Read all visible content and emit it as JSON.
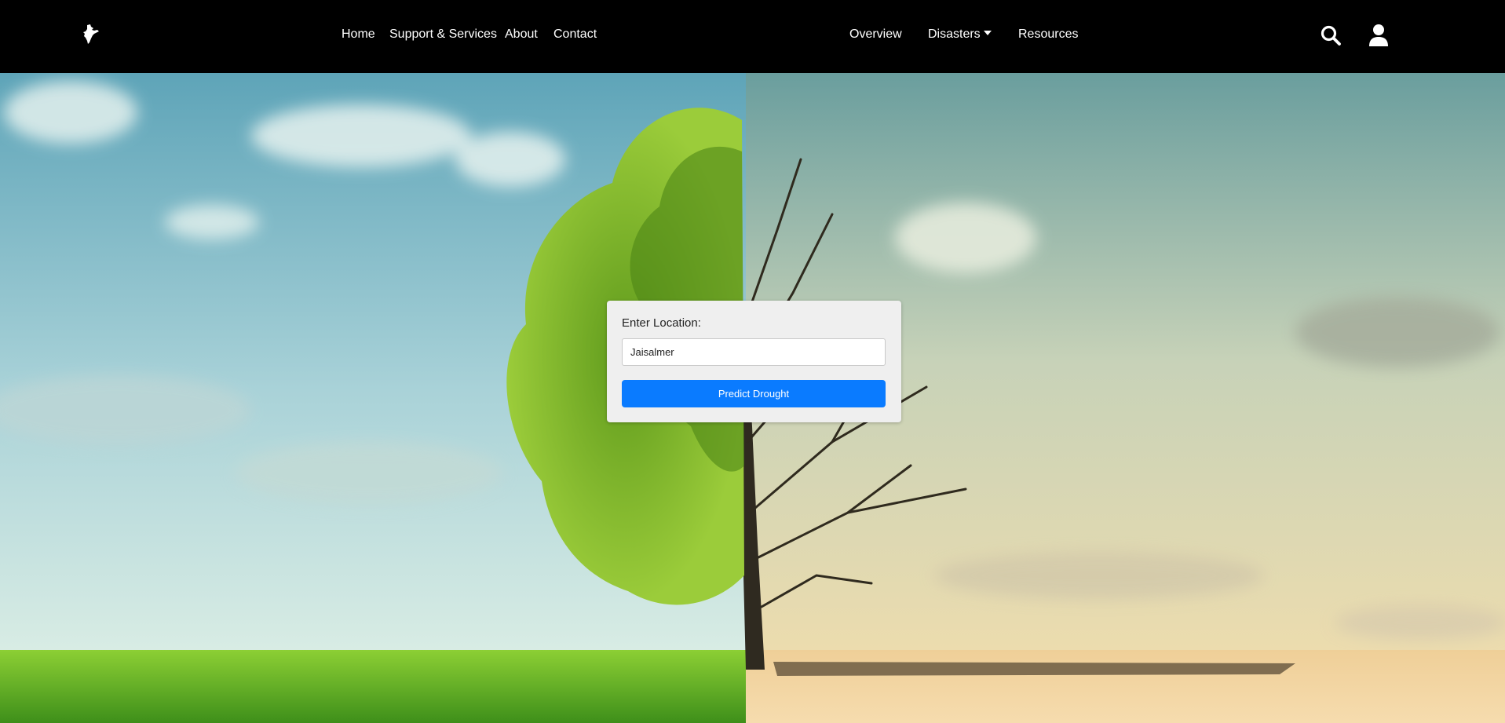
{
  "navbar": {
    "logo_icon": "india-map-icon",
    "left_links": [
      "Home",
      "Support & Services",
      "About",
      "Contact"
    ],
    "right_links": {
      "overview": "Overview",
      "disasters": "Disasters",
      "resources": "Resources"
    },
    "search_icon": "search-icon",
    "user_icon": "user-icon"
  },
  "form": {
    "label": "Enter Location:",
    "location_value": "Jaisalmer",
    "submit_label": "Predict Drought"
  },
  "colors": {
    "navbar_bg": "#000000",
    "button_bg": "#0a7bff",
    "card_bg": "#efefef"
  }
}
